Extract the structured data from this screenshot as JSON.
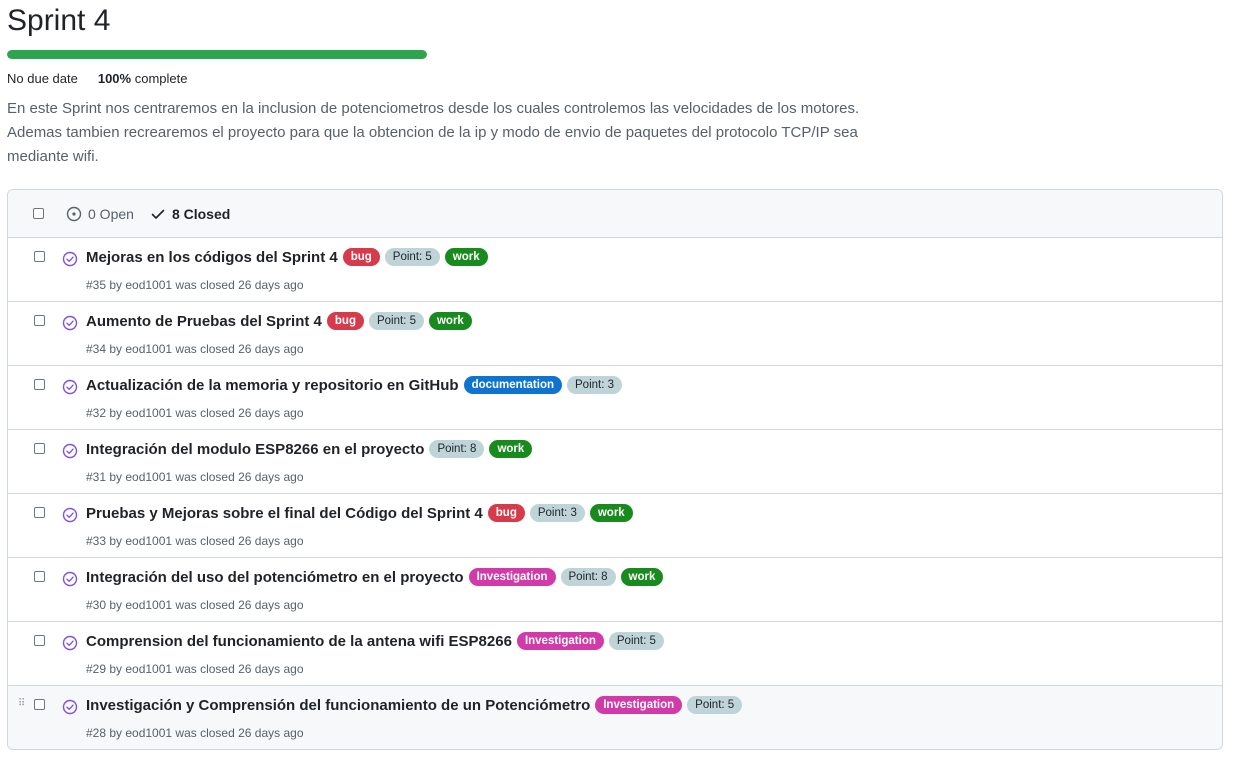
{
  "milestone": {
    "title": "Sprint 4",
    "progress_percent": 100,
    "due": "No due date",
    "complete_pct": "100%",
    "complete_word": "complete",
    "description_lines": [
      "En este Sprint nos centraremos en la inclusion de potenciometros desde los cuales controlemos las velocidades de los motores.",
      "Ademas tambien recrearemos el proyecto para que la obtencion de la ip y modo de envio de paquetes del protocolo TCP/IP sea",
      "mediante wifi."
    ]
  },
  "header": {
    "open_label": "0 Open",
    "closed_label": "8 Closed"
  },
  "colors": {
    "progress": "#2da44e",
    "closed_icon": "#8250df",
    "bug": "#d73a4a",
    "work": "#198a1e",
    "point": "#bfd4d8",
    "documentation": "#0e74d0",
    "investigation": "#d13aa8"
  },
  "issues": [
    {
      "title": "Mejoras en los códigos del Sprint 4",
      "labels": [
        {
          "text": "bug",
          "kind": "bug"
        },
        {
          "text": "Point: 5",
          "kind": "point"
        },
        {
          "text": "work",
          "kind": "work"
        }
      ],
      "meta": "#35 by eod1001 was closed 26 days ago"
    },
    {
      "title": "Aumento de Pruebas del Sprint 4",
      "labels": [
        {
          "text": "bug",
          "kind": "bug"
        },
        {
          "text": "Point: 5",
          "kind": "point"
        },
        {
          "text": "work",
          "kind": "work"
        }
      ],
      "meta": "#34 by eod1001 was closed 26 days ago"
    },
    {
      "title": "Actualización de la memoria y repositorio en GitHub",
      "labels": [
        {
          "text": "documentation",
          "kind": "documentation"
        },
        {
          "text": "Point: 3",
          "kind": "point"
        }
      ],
      "meta": "#32 by eod1001 was closed 26 days ago"
    },
    {
      "title": "Integración del modulo ESP8266 en el proyecto",
      "labels": [
        {
          "text": "Point: 8",
          "kind": "point"
        },
        {
          "text": "work",
          "kind": "work"
        }
      ],
      "meta": "#31 by eod1001 was closed 26 days ago"
    },
    {
      "title": "Pruebas y Mejoras sobre el final del Código del Sprint 4",
      "labels": [
        {
          "text": "bug",
          "kind": "bug"
        },
        {
          "text": "Point: 3",
          "kind": "point"
        },
        {
          "text": "work",
          "kind": "work"
        }
      ],
      "meta": "#33 by eod1001 was closed 26 days ago"
    },
    {
      "title": "Integración del uso del potenciómetro en el proyecto",
      "labels": [
        {
          "text": "Investigation",
          "kind": "investigation"
        },
        {
          "text": "Point: 8",
          "kind": "point"
        },
        {
          "text": "work",
          "kind": "work"
        }
      ],
      "meta": "#30 by eod1001 was closed 26 days ago"
    },
    {
      "title": "Comprension del funcionamiento de la antena wifi ESP8266",
      "labels": [
        {
          "text": "Investigation",
          "kind": "investigation"
        },
        {
          "text": "Point: 5",
          "kind": "point"
        }
      ],
      "meta": "#29 by eod1001 was closed 26 days ago"
    },
    {
      "title": "Investigación y Comprensión del funcionamiento de un Potenciómetro",
      "labels": [
        {
          "text": "Investigation",
          "kind": "investigation"
        },
        {
          "text": "Point: 5",
          "kind": "point"
        }
      ],
      "meta": "#28 by eod1001 was closed 26 days ago",
      "drag_handle": "⠿"
    }
  ]
}
